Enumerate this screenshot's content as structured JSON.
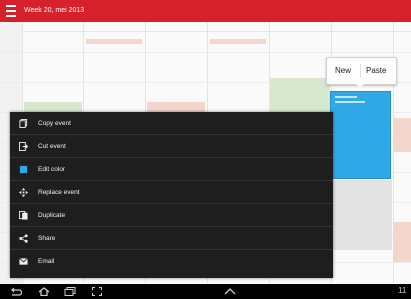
{
  "header": {
    "title": "Week 20, mei 2013",
    "color": "#d6212b"
  },
  "bubble": {
    "new_label": "New",
    "paste_label": "Paste"
  },
  "menu": {
    "items": [
      {
        "label": "Copy event",
        "icon": "copy-icon"
      },
      {
        "label": "Cut event",
        "icon": "cut-icon"
      },
      {
        "label": "Edit color",
        "icon": "color-square-icon",
        "icon_color": "#2ea9e6"
      },
      {
        "label": "Replace event",
        "icon": "move-icon"
      },
      {
        "label": "Duplicate",
        "icon": "duplicate-icon"
      },
      {
        "label": "Share",
        "icon": "share-icon"
      },
      {
        "label": "Email",
        "icon": "email-icon"
      }
    ]
  },
  "navbar": {
    "clock": "11"
  },
  "colors": {
    "event_green": "#d7e8cf",
    "event_salmon": "#f3d6cc",
    "event_blue": "#2ea9e6"
  }
}
